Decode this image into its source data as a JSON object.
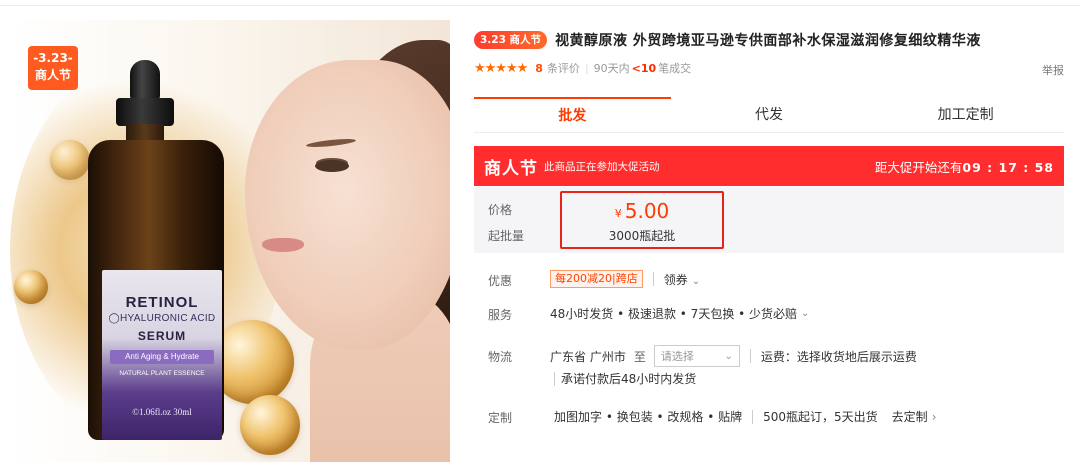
{
  "image": {
    "promo_badge_line1": "-3.23-",
    "promo_badge_line2": "商人节",
    "bottle_brand": "RETINOL",
    "bottle_line2": "HYALURONIC ACID",
    "bottle_line3": "SERUM",
    "bottle_tag": "Anti Aging & Hydrate",
    "bottle_sub": "NATURAL PLANT ESSENCE",
    "bottle_volume": "1.06fl.oz 30ml"
  },
  "title": {
    "badge": "3.23 商人节",
    "text": "视黄醇原液 外贸跨境亚马逊专供面部补水保湿滋润修复细纹精华液"
  },
  "rating": {
    "stars": "★★★★★",
    "review_count": "8",
    "review_label": "条评价",
    "days_label": "90天内",
    "deals_value": "<10",
    "deals_label": "笔成交",
    "report": "举报"
  },
  "tabs": [
    {
      "label": "批发",
      "active": true
    },
    {
      "label": "代发",
      "active": false
    },
    {
      "label": "加工定制",
      "active": false
    }
  ],
  "promo": {
    "name": "商人节",
    "note": "此商品正在参加大促活动",
    "countdown_label": "距大促开始还有",
    "countdown_value": "09 : 17 : 58"
  },
  "price": {
    "label": "价格",
    "currency": "¥",
    "value": "5.00",
    "moq_label": "起批量",
    "moq_value": "3000瓶起批"
  },
  "discount": {
    "label": "优惠",
    "coupon": "每200减20|跨店",
    "claim": "领券"
  },
  "service": {
    "label": "服务",
    "text": "48小时发货 • 极速退款 • 7天包换 • 少货必赔"
  },
  "logistics": {
    "label": "物流",
    "origin": "广东省 广州市",
    "to": "至",
    "select_placeholder": "请选择",
    "freight": "运费：选择收货地后展示运费",
    "promise": "承诺付款后48小时内发货"
  },
  "custom": {
    "label": "定制",
    "options": "加图加字 • 换包装 • 改规格 • 贴牌",
    "moq": "500瓶起订，5天出货",
    "link": "去定制"
  },
  "colors": {
    "accent": "#ff3b00",
    "promo_bar": "#ff2d2d",
    "highlight_box": "#e8231a"
  }
}
